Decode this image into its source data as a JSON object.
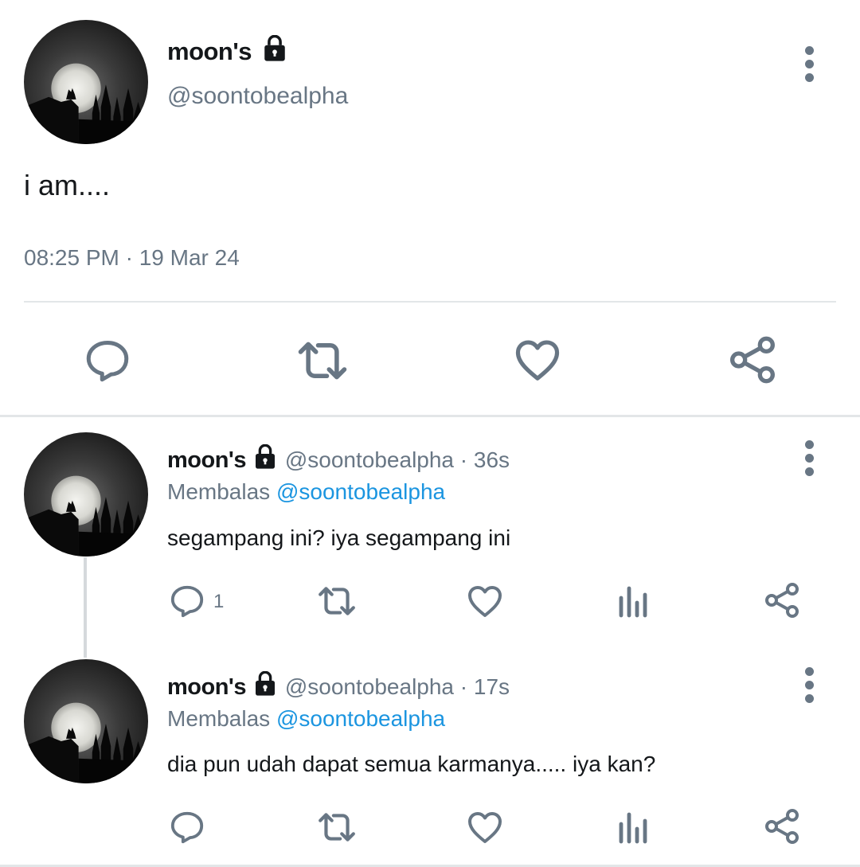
{
  "colors": {
    "icon_gray": "#687684",
    "link_blue": "#1b95e0",
    "divider": "#e3e6e8"
  },
  "main_tweet": {
    "display_name": "moon's",
    "handle": "@soontobealpha",
    "text": "i am....",
    "timestamp": "08:25 PM · 19 Mar 24",
    "locked_icon": "lock-icon",
    "actions": [
      "reply-icon",
      "retweet-icon",
      "like-icon",
      "share-icon"
    ]
  },
  "replies": [
    {
      "display_name": "moon's",
      "meta": "@soontobealpha · 36s",
      "replying_prefix": "Membalas",
      "replying_to": "@soontobealpha",
      "text": "segampang ini? iya segampang ini",
      "reply_count": "1"
    },
    {
      "display_name": "moon's",
      "meta": "@soontobealpha · 17s",
      "replying_prefix": "Membalas",
      "replying_to": "@soontobealpha",
      "text": "dia pun udah dapat semua karmanya..... iya kan?",
      "reply_count": ""
    }
  ]
}
